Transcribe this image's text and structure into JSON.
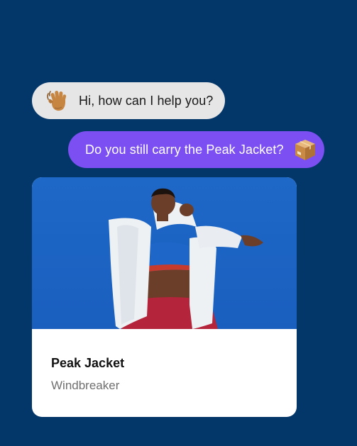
{
  "chat": {
    "incoming": {
      "text": "Hi, how can I help you?",
      "emoji": "waving-hand-icon"
    },
    "outgoing": {
      "text": "Do you still carry the Peak Jacket?",
      "emoji": "package-box-icon"
    }
  },
  "product": {
    "name": "Peak Jacket",
    "category": "Windbreaker",
    "image": "woman-in-white-jacket-photo"
  },
  "colors": {
    "background": "#033669",
    "incoming_bubble": "#e6e6e6",
    "outgoing_bubble": "#7b4ff2",
    "card": "#ffffff",
    "photo_sky": "#1e6fd0"
  }
}
